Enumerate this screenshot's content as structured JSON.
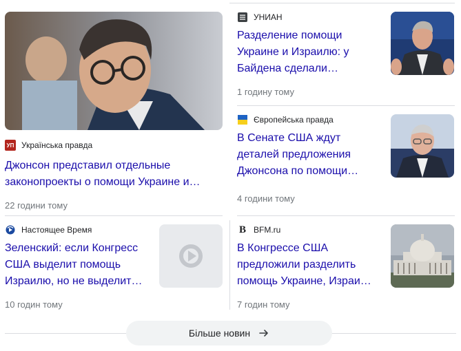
{
  "cards": [
    {
      "source": "Українська правда",
      "title_line1": "Джонсон представил отдельные",
      "title_line2": "законопроекты о помощи Украине и…",
      "time": "22 години тому"
    },
    {
      "source": "УНИАН",
      "title_line1": "Разделение помощи",
      "title_line2": "Украине и Израилю: у",
      "title_line3": "Байдена сделали…",
      "time": "1 годину тому"
    },
    {
      "source": "Європейська правда",
      "title_line1": "В Сенате США ждут",
      "title_line2": "деталей предложения",
      "title_line3": "Джонсона по помощи…",
      "time": "4 години тому"
    },
    {
      "source": "Настоящее Время",
      "title_line1": "Зеленский: если Конгресс",
      "title_line2": "США выделит помощь",
      "title_line3": "Израилю, но не выделит…",
      "time": "10 годин тому"
    },
    {
      "source": "BFM.ru",
      "title_line1": "В Конгрессе США",
      "title_line2": "предложили разделить",
      "title_line3": "помощь Украине, Израи…",
      "time": "7 годин тому"
    }
  ],
  "logos": {
    "up": "УП",
    "bfm": "B"
  },
  "more_button": {
    "label": "Більше новин"
  },
  "colors": {
    "link": "#1a0dab",
    "meta": "#70757a",
    "divider": "#dadce0"
  }
}
